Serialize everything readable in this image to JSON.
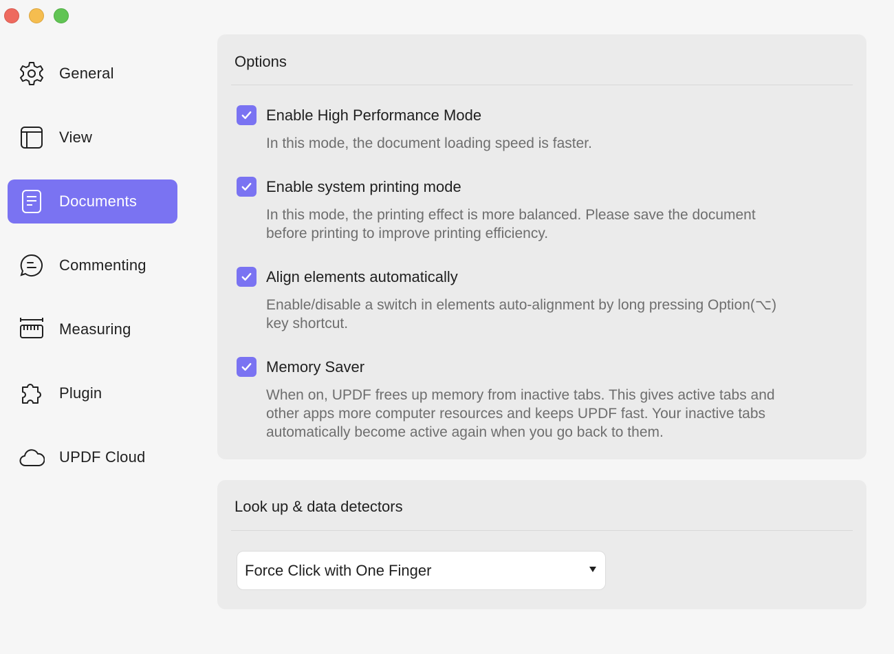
{
  "sidebar": {
    "items": [
      {
        "label": "General",
        "icon": "gear-icon",
        "active": false
      },
      {
        "label": "View",
        "icon": "layout-icon",
        "active": false
      },
      {
        "label": "Documents",
        "icon": "document-icon",
        "active": true
      },
      {
        "label": "Commenting",
        "icon": "comment-icon",
        "active": false
      },
      {
        "label": "Measuring",
        "icon": "ruler-icon",
        "active": false
      },
      {
        "label": "Plugin",
        "icon": "puzzle-icon",
        "active": false
      },
      {
        "label": "UPDF Cloud",
        "icon": "cloud-icon",
        "active": false
      }
    ]
  },
  "options_panel": {
    "title": "Options",
    "options": [
      {
        "title": "Enable High Performance Mode",
        "checked": true,
        "desc_lines": [
          "In this mode, the document loading speed is faster."
        ]
      },
      {
        "title": "Enable system printing mode",
        "checked": true,
        "desc_lines": [
          "In this mode, the printing effect is more balanced. Please save the document",
          "before printing to improve printing efficiency."
        ]
      },
      {
        "title": "Align elements automatically",
        "checked": true,
        "desc_lines": [
          "Enable/disable a switch in elements auto-alignment by long pressing Option(⌥)",
          "key shortcut."
        ]
      },
      {
        "title": "Memory Saver",
        "checked": true,
        "desc_lines": [
          "When on, UPDF frees up memory from inactive tabs. This gives active tabs and",
          "other apps more computer resources and keeps UPDF fast. Your inactive tabs",
          "automatically become active again when you go back to them."
        ]
      }
    ]
  },
  "lookup_panel": {
    "title": "Look up & data detectors",
    "select_value": "Force Click with One Finger"
  },
  "colors": {
    "accent": "#7a73f2",
    "close": "#ee6a5f",
    "minimize": "#f5bd4f",
    "zoom": "#61c454"
  }
}
